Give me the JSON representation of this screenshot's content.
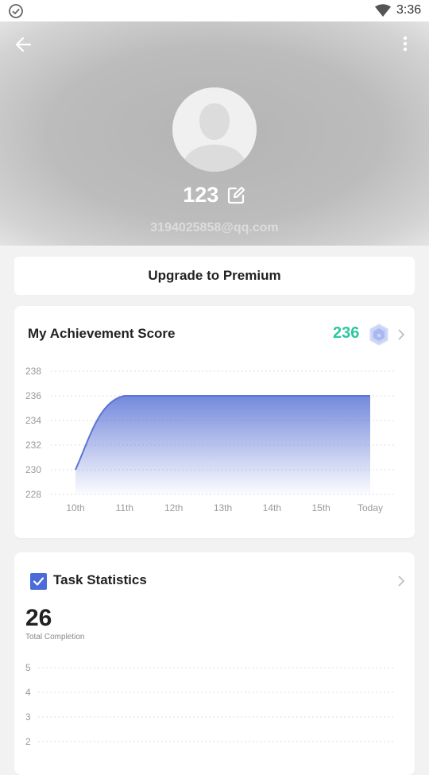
{
  "status_bar": {
    "time": "3:36"
  },
  "profile": {
    "username": "123",
    "email": "3194025858@qq.com"
  },
  "premium": {
    "label": "Upgrade to Premium"
  },
  "achievement": {
    "title": "My Achievement Score",
    "score": "236",
    "accent_color": "#2cc7a0"
  },
  "tasks": {
    "title": "Task Statistics",
    "total": "26",
    "total_label": "Total Completion"
  },
  "chart_data": [
    {
      "type": "area",
      "categories": [
        "10th",
        "11th",
        "12th",
        "13th",
        "14th",
        "15th",
        "Today"
      ],
      "values": [
        230,
        236,
        236,
        236,
        236,
        236,
        236
      ],
      "yticks": [
        228,
        230,
        232,
        234,
        236,
        238
      ],
      "ylim": [
        228,
        238
      ],
      "grid": true,
      "color": "#5b74d6"
    },
    {
      "type": "line",
      "yticks": [
        2,
        3,
        4,
        5
      ],
      "grid": true
    }
  ]
}
